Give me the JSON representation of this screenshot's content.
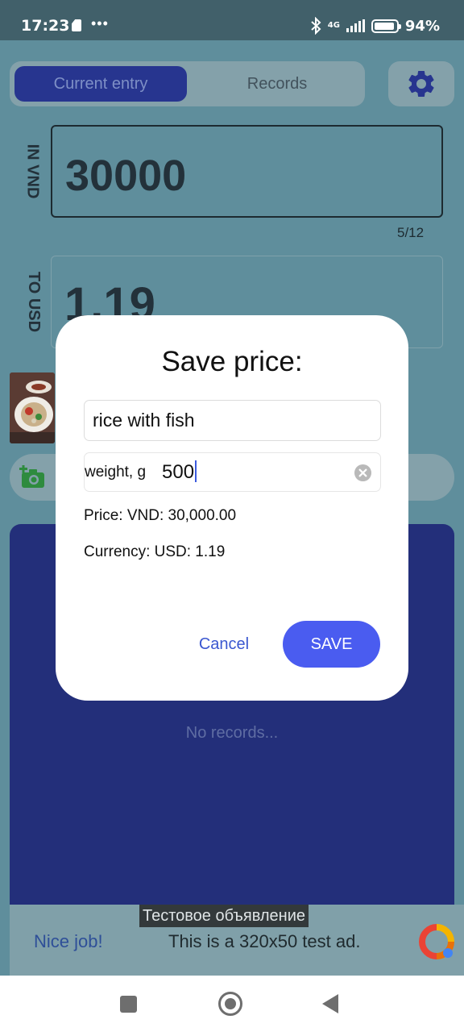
{
  "status_bar": {
    "time": "17:23",
    "network": "4G",
    "battery": "94%",
    "battery_level": 0.94
  },
  "tabs": {
    "current_entry": "Current entry",
    "records": "Records",
    "active": "current_entry"
  },
  "converter": {
    "input_label": "IN VND",
    "input_value": "30000",
    "input_counter": "5/12",
    "output_label": "TO USD",
    "output_value": "1.19"
  },
  "records": {
    "empty_text": "No records..."
  },
  "dialog": {
    "title": "Save price:",
    "name_value": "rice with fish",
    "weight_prefix": "weight, g",
    "weight_value": "500",
    "price_line": "Price: VND: 30,000.00",
    "currency_line": "Currency: USD: 1.19",
    "cancel_label": "Cancel",
    "save_label": "SAVE"
  },
  "ad": {
    "tag": "Тестовое объявление",
    "link": "Nice job!",
    "text": "This is a 320x50 test ad."
  },
  "icons": {
    "settings": "gear-icon",
    "add_photo": "camera-plus-icon",
    "clear": "clear-circle-icon",
    "bluetooth": "bluetooth-icon",
    "signal": "signal-icon",
    "battery": "battery-icon"
  },
  "colors": {
    "accent": "#4a5cf0",
    "tab_active": "#27358f",
    "records_panel": "#232f7a",
    "camera_green": "#2e8b3e"
  }
}
